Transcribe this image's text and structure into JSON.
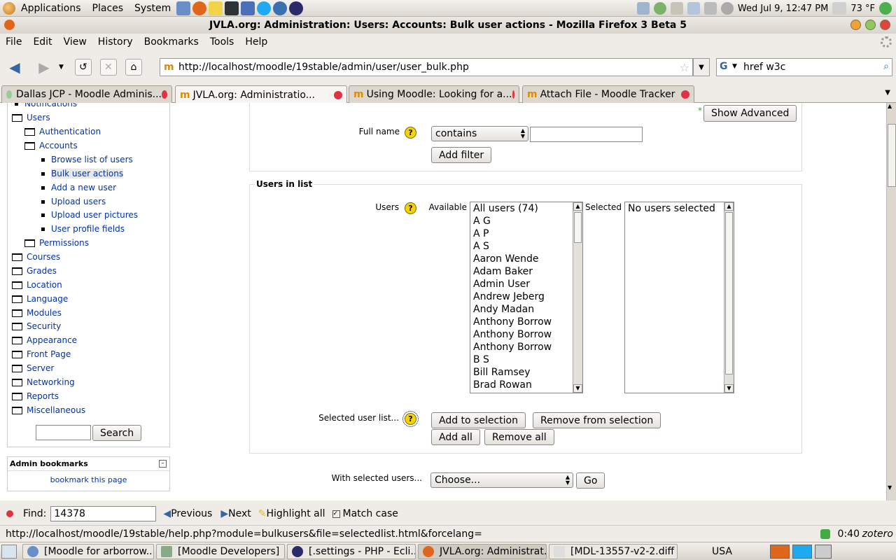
{
  "panel": {
    "menus": [
      "Applications",
      "Places",
      "System"
    ],
    "clock": "Wed Jul  9, 12:47 PM",
    "temperature": "73 °F"
  },
  "window": {
    "title": "JVLA.org: Administration: Users: Accounts: Bulk user actions - Mozilla Firefox 3 Beta 5"
  },
  "menubar": [
    "File",
    "Edit",
    "View",
    "History",
    "Bookmarks",
    "Tools",
    "Help"
  ],
  "nav": {
    "url": "http://localhost/moodle/19stable/admin/user/user_bulk.php",
    "search_value": "href w3c"
  },
  "tabs": [
    {
      "label": "Dallas JCP - Moodle Adminis..."
    },
    {
      "label": "JVLA.org: Administratio..."
    },
    {
      "label": "Using Moodle: Looking for a..."
    },
    {
      "label": "Attach File - Moodle Tracker"
    }
  ],
  "sidebar": {
    "items": [
      "Notifications",
      "Users",
      "Authentication",
      "Accounts",
      "Browse list of users",
      "Bulk user actions",
      "Add a new user",
      "Upload users",
      "Upload user pictures",
      "User profile fields",
      "Permissions",
      "Courses",
      "Grades",
      "Location",
      "Language",
      "Modules",
      "Security",
      "Appearance",
      "Front Page",
      "Server",
      "Networking",
      "Reports",
      "Miscellaneous"
    ],
    "search_button": "Search",
    "bookmarks_title": "Admin bookmarks",
    "bookmark_link": "bookmark this page"
  },
  "filter": {
    "show_advanced": "Show Advanced",
    "fullname_label": "Full name",
    "operator": "contains",
    "add_filter": "Add filter"
  },
  "users_in_list": {
    "legend": "Users in list",
    "users_label": "Users",
    "available_label": "Available",
    "selected_label": "Selected",
    "available": [
      "All users (74)",
      "A G",
      "A P",
      "A S",
      "Aaron Wende",
      "Adam Baker",
      "Admin User",
      "Andrew Jeberg",
      "Andy Madan",
      "Anthony Borrow",
      "Anthony Borrow",
      "Anthony Borrow",
      "B S",
      "Bill Ramsey",
      "Brad Rowan"
    ],
    "selected": [
      "No users selected"
    ],
    "selected_list_label": "Selected user list...",
    "add_to_selection": "Add to selection",
    "remove_from_selection": "Remove from selection",
    "add_all": "Add all",
    "remove_all": "Remove all"
  },
  "actions": {
    "label": "With selected users...",
    "choose": "Choose...",
    "go": "Go"
  },
  "findbar": {
    "label": "Find:",
    "value": "14378",
    "previous": "Previous",
    "next": "Next",
    "highlight": "Highlight all",
    "match_case": "Match case"
  },
  "status": {
    "text": "http://localhost/moodle/19stable/help.php?module=bulkusers&file=selectedlist.html&forcelang=",
    "timer": "0:40",
    "zotero": "zotero"
  },
  "taskbar": {
    "items": [
      "[Moodle for arborrow...",
      "[Moodle Developers]",
      "[.settings - PHP - Ecli...",
      "JVLA.org: Administrat...",
      "[MDL-13557-v2-2.diff ..."
    ],
    "locale": "USA"
  }
}
